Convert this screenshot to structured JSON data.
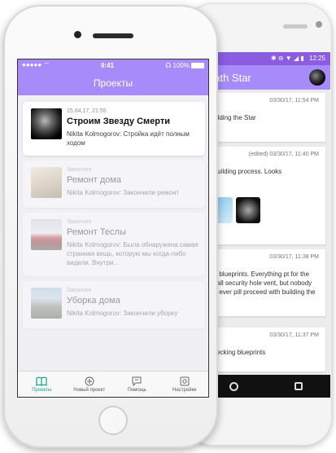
{
  "back_phone": {
    "status": {
      "time": "12:25",
      "icons": "✱ ⊖ ▼ ◢ ▮"
    },
    "title": "eath Star",
    "messages": [
      {
        "meta": "03/30/17, 11:54 PM",
        "who": "ov",
        "body": "Building the Star"
      },
      {
        "meta": "(edited) 03/30/17, 11:40 PM",
        "who": "ov",
        "body": "e building process. Looks"
      },
      {
        "meta": "",
        "who": "",
        "body": ""
      },
      {
        "meta": "03/30/17, 11:38 PM",
        "who": "ov",
        "body": "the blueprints. Everything pt for the small security hole vent, but nobody will ever pill proceed with building the"
      },
      {
        "meta": "03/30/17, 11:37 PM",
        "who": "ov",
        "body": "Checking blueprints"
      }
    ]
  },
  "front_phone": {
    "status": {
      "carrier": "●●●●● ⌔",
      "time": "9:41",
      "battery": "☊ 100%"
    },
    "nav_title": "Проекты",
    "cards": [
      {
        "date": "15.04.17, 21:55",
        "title": "Строим Звезду Смерти",
        "text": "Nikita Kolmogorov: Стройка идёт полным ходом",
        "image": "death-star"
      },
      {
        "date": "Закончен",
        "title": "Ремонт дома",
        "text": "Nikita Kolmogorov: Закончили ремонт",
        "image": "room"
      },
      {
        "date": "Закончен",
        "title": "Ремонт Теслы",
        "text": "Nikita Kolmogorov: Была обнаружена самая странная вещь, которую мы когда-либо видели. Внутри...",
        "image": "car"
      },
      {
        "date": "Закончен",
        "title": "Уборка дома",
        "text": "Nikita Kolmogorov: Закончили уборку",
        "image": "house"
      }
    ],
    "tabs": [
      {
        "label": "Проекты",
        "icon": "book-icon",
        "active": true
      },
      {
        "label": "Новый проект",
        "icon": "plus-circle-icon",
        "active": false
      },
      {
        "label": "Помощь",
        "icon": "chat-icon",
        "active": false
      },
      {
        "label": "Настройки",
        "icon": "gear-icon",
        "active": false
      }
    ],
    "accent_color": "#a78bfa",
    "active_tab_color": "#16a085"
  }
}
